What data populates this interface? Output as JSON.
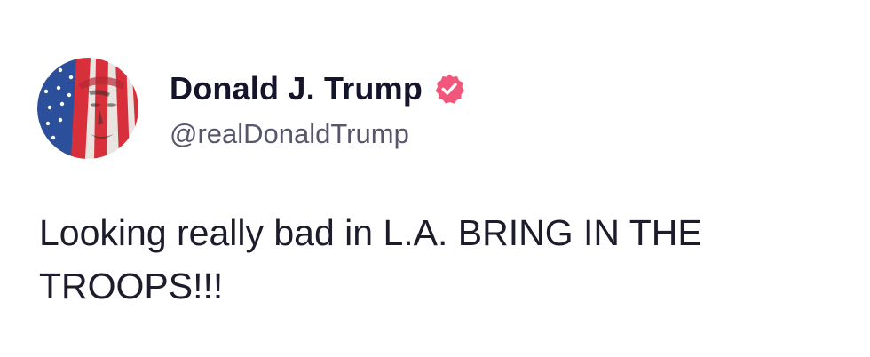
{
  "post": {
    "author": {
      "display_name": "Donald J. Trump",
      "handle": "@realDonaldTrump",
      "verified": true,
      "verified_badge_color": "#f0577a"
    },
    "text": "Looking really bad in L.A. BRING IN THE TROOPS!!!"
  },
  "icons": {
    "avatar": "profile-avatar-flag-portrait",
    "badge": "verified-check-badge-icon"
  }
}
